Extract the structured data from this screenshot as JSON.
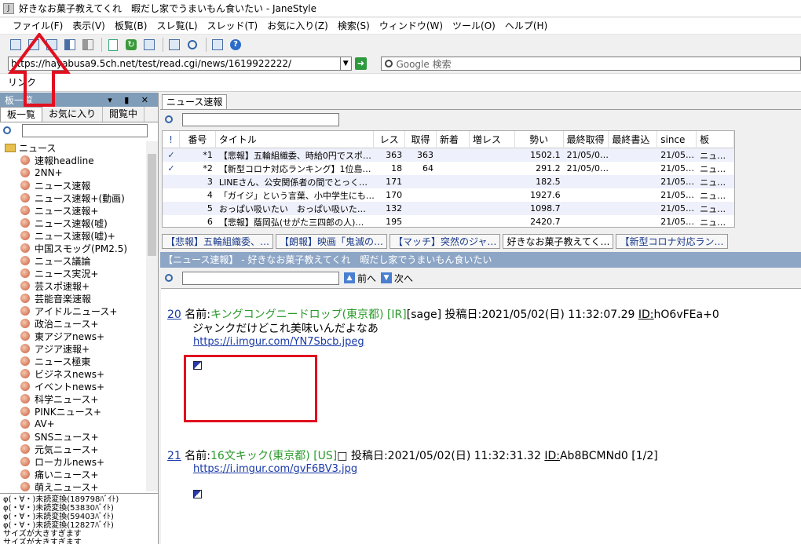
{
  "window": {
    "title": "好きなお菓子教えてくれ　暇だし家でうまいもん食いたい - JaneStyle",
    "app_icon": "J"
  },
  "menu": [
    "ファイル(F)",
    "表示(V)",
    "板覧(B)",
    "スレ覧(L)",
    "スレッド(T)",
    "お気に入り(Z)",
    "検索(S)",
    "ウィンドウ(W)",
    "ツール(O)",
    "ヘルプ(H)"
  ],
  "address": {
    "url": "https://hayabusa9.5ch.net/test/read.cgi/news/1619922222/",
    "search_placeholder": "Google 検索",
    "link_label": "リンク"
  },
  "left_panel": {
    "title": "板一覧",
    "tabs": [
      "板一覧",
      "お気に入り",
      "閲覧中"
    ],
    "root_folder": "ニュース",
    "boards": [
      "速報headline",
      "2NN+",
      "ニュース速報",
      "ニュース速報+(動画)",
      "ニュース速報+",
      "ニュース速報(嘘)",
      "ニュース速報(嘘)+",
      "中国スモッグ(PM2.5)",
      "ニュース議論",
      "ニュース実況+",
      "芸スポ速報+",
      "芸能音楽速報",
      "アイドルニュース+",
      "政治ニュース+",
      "東アジアnews+",
      "アジア速報+",
      "ニュース極東",
      "ビジネスnews+",
      "イベントnews+",
      "科学ニュース+",
      "PINKニュース+",
      "AV+",
      "SNSニュース+",
      "元気ニュース+",
      "ローカルnews+",
      "痛いニュース+",
      "萌えニュース+"
    ],
    "log": [
      "φ(・∀・)未読変換(189798ﾊﾞｲﾄ)",
      "φ(・∀・)未読変換(53830ﾊﾞｲﾄ)",
      "φ(・∀・)未読変換(59403ﾊﾞｲﾄ)",
      "φ(・∀・)未読変換(12827ﾊﾞｲﾄ)",
      "サイズが大きすぎます",
      "サイズが大きすぎます"
    ]
  },
  "board_tab": "ニュース速報",
  "thread_list": {
    "columns": [
      "!",
      "番号",
      "タイトル",
      "レス",
      "取得",
      "新着",
      "増レス",
      "勢い",
      "最終取得",
      "最終書込",
      "since",
      "板"
    ],
    "rows": [
      {
        "mark": "✓",
        "num": "*1",
        "title": "【悲報】五輪組織委、時給0円でスポ…",
        "res": "363",
        "got": "363",
        "new": "",
        "inc": "",
        "momentum": "1502.1",
        "last_get": "21/05/0…",
        "last_post": "",
        "since": "21/05…",
        "board": "ニュ…"
      },
      {
        "mark": "✓",
        "num": "*2",
        "title": "【新型コロナ対応ランキング】1位島…",
        "res": "18",
        "got": "64",
        "new": "",
        "inc": "",
        "momentum": "291.2",
        "last_get": "21/05/0…",
        "last_post": "",
        "since": "21/05…",
        "board": "ニュ…"
      },
      {
        "mark": "",
        "num": "3",
        "title": "LINEさん、公安関係者の間でとっく…",
        "res": "171",
        "got": "",
        "new": "",
        "inc": "",
        "momentum": "182.5",
        "last_get": "",
        "last_post": "",
        "since": "21/05…",
        "board": "ニュ…"
      },
      {
        "mark": "",
        "num": "4",
        "title": "「ガイジ」という言葉、小中学生にも…",
        "res": "170",
        "got": "",
        "new": "",
        "inc": "",
        "momentum": "1927.6",
        "last_get": "",
        "last_post": "",
        "since": "21/05…",
        "board": "ニュ…"
      },
      {
        "mark": "",
        "num": "5",
        "title": "おっぱい吸いたい　おっぱい吸いた…",
        "res": "132",
        "got": "",
        "new": "",
        "inc": "",
        "momentum": "1098.7",
        "last_get": "",
        "last_post": "",
        "since": "21/05…",
        "board": "ニュ…"
      },
      {
        "mark": "",
        "num": "6",
        "title": "【悲報】蔭岡弘(せがた三四郎の人)…",
        "res": "195",
        "got": "",
        "new": "",
        "inc": "",
        "momentum": "2420.7",
        "last_get": "",
        "last_post": "",
        "since": "21/05…",
        "board": "ニュ…"
      }
    ]
  },
  "thread_tabs": [
    "【悲報】五輪組織委、…",
    "【朗報】映画「鬼滅の…",
    "【マッチ】突然のジャ…",
    "好きなお菓子教えてく…",
    "【新型コロナ対応ラン…"
  ],
  "thread_header": "【ニュース速報】 - 好きなお菓子教えてくれ　暇だし家でうまいもん食いたい",
  "view_nav": {
    "prev": "前へ",
    "next": "次へ"
  },
  "posts": [
    {
      "num": "20",
      "name_label": "名前:",
      "name": "キングコングニードロップ(東京都)",
      "tag": "[IR]",
      "mail": "[sage]",
      "date": "投稿日:2021/05/02(日) 11:32:07.29",
      "id_label": "ID:",
      "id": "hO6vFEa+0",
      "body": "ジャンクだけどこれ美味いんだよなあ",
      "link": "https://i.imgur.com/YN7Sbcb.jpeg"
    },
    {
      "num": "21",
      "name_label": "名前:",
      "name": "16文キック(東京都)",
      "tag": "[US]",
      "mail": "",
      "date": "投稿日:2021/05/02(日) 11:32:31.32",
      "id_label": "ID:",
      "id": "Ab8BCMNd0 [1/2]",
      "body": "",
      "link": "https://i.imgur.com/gvF6BV3.jpg"
    }
  ],
  "colors": {
    "annotation": "#e01020",
    "link": "#1a3aa8",
    "name": "#2a9a2a",
    "header": "#8ea6c6"
  }
}
